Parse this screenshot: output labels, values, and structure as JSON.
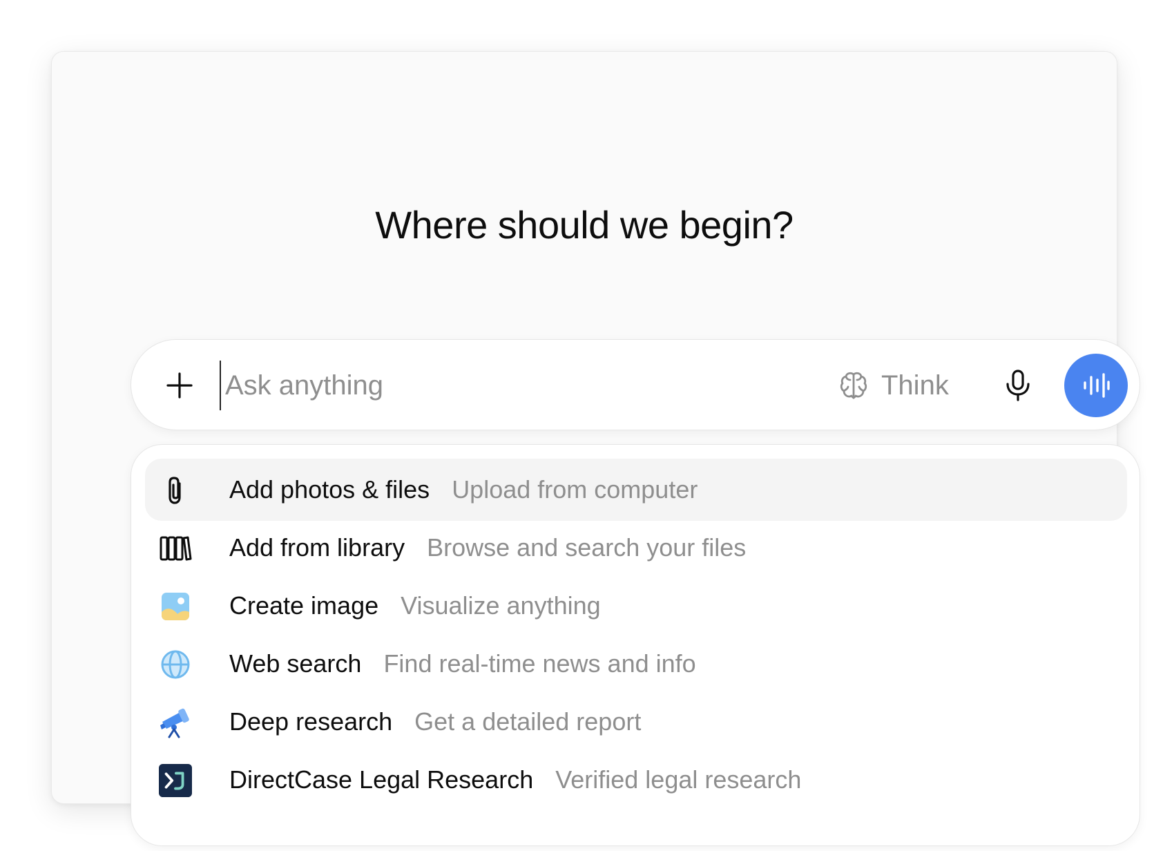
{
  "heading": "Where should we begin?",
  "composer": {
    "placeholder": "Ask anything",
    "value": "",
    "think_label": "Think",
    "plus_icon": "plus-icon",
    "think_icon": "brain-icon",
    "mic_icon": "microphone-icon",
    "voice_icon": "voice-waveform-icon",
    "voice_button_color": "#4a84f0"
  },
  "menu": {
    "items": [
      {
        "title": "Add photos & files",
        "desc": "Upload from computer",
        "icon": "paperclip-icon",
        "active": true
      },
      {
        "title": "Add from library",
        "desc": "Browse and search your files",
        "icon": "library-icon"
      },
      {
        "title": "Create image",
        "desc": "Visualize anything",
        "icon": "image-icon"
      },
      {
        "title": "Web search",
        "desc": "Find real-time news and info",
        "icon": "globe-icon"
      },
      {
        "title": "Deep research",
        "desc": "Get a detailed report",
        "icon": "telescope-icon"
      },
      {
        "title": "DirectCase Legal Research",
        "desc": "Verified legal research",
        "icon": "directcase-logo-icon"
      }
    ]
  }
}
